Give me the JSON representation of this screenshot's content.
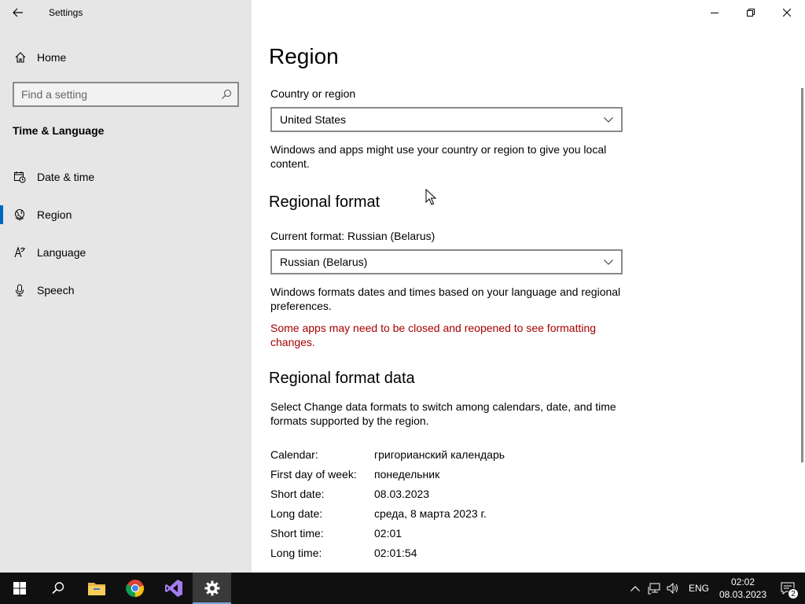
{
  "window": {
    "title": "Settings",
    "controls": {
      "minimize": "minimize-icon",
      "restore": "restore-icon",
      "close": "close-icon"
    }
  },
  "sidebar": {
    "home_label": "Home",
    "search_placeholder": "Find a setting",
    "section_title": "Time & Language",
    "items": [
      {
        "label": "Date & time",
        "icon": "calendar-clock-icon",
        "active": false
      },
      {
        "label": "Region",
        "icon": "globe-icon",
        "active": true
      },
      {
        "label": "Language",
        "icon": "language-icon",
        "active": false
      },
      {
        "label": "Speech",
        "icon": "microphone-icon",
        "active": false
      }
    ]
  },
  "main": {
    "title": "Region",
    "country_label": "Country or region",
    "country_value": "United States",
    "country_desc": "Windows and apps might use your country or region to give you local content.",
    "regional_format_heading": "Regional format",
    "current_format_label": "Current format: Russian (Belarus)",
    "format_value": "Russian (Belarus)",
    "format_desc": "Windows formats dates and times based on your language and regional preferences.",
    "format_warning": "Some apps may need to be closed and reopened to see formatting changes.",
    "format_data_heading": "Regional format data",
    "format_data_desc": "Select Change data formats to switch among calendars, date, and time formats supported by the region.",
    "format_data": [
      {
        "key": "Calendar:",
        "value": "григорианский календарь"
      },
      {
        "key": "First day of week:",
        "value": "понедельник"
      },
      {
        "key": "Short date:",
        "value": "08.03.2023"
      },
      {
        "key": "Long date:",
        "value": "среда, 8 марта 2023 г."
      },
      {
        "key": "Short time:",
        "value": "02:01"
      },
      {
        "key": "Long time:",
        "value": "02:01:54"
      }
    ]
  },
  "taskbar": {
    "apps": [
      "start-icon",
      "search-icon",
      "file-explorer-icon",
      "chrome-icon",
      "visual-studio-icon",
      "settings-gear-icon"
    ],
    "language": "ENG",
    "time": "02:02",
    "date": "08.03.2023",
    "notification_count": "2"
  },
  "colors": {
    "accent": "#0067c0",
    "warning": "#a80000",
    "sidebar_bg": "#e6e6e6",
    "taskbar_bg": "#101010"
  }
}
